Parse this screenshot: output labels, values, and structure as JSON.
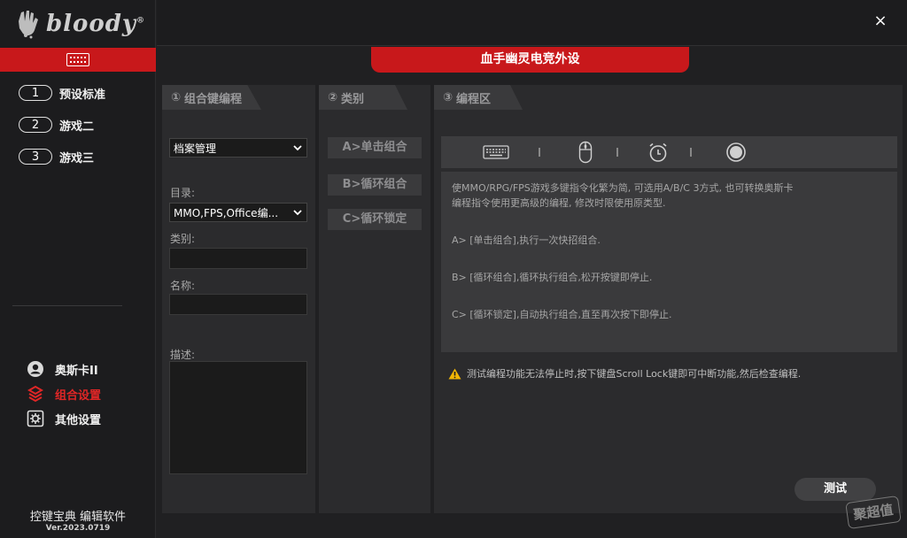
{
  "app": {
    "logo_text": "bloody",
    "logo_trademark": "®",
    "banner_title": "血手幽灵电竞外设",
    "close_symbol": "×",
    "accent_color": "#c8181b"
  },
  "sidebar": {
    "profiles": [
      {
        "number": "1",
        "label": "预设标准"
      },
      {
        "number": "2",
        "label": "游戏二"
      },
      {
        "number": "3",
        "label": "游戏三"
      }
    ],
    "menu": [
      {
        "label": "奥斯卡II",
        "icon": "oscar-icon",
        "active": false
      },
      {
        "label": "组合设置",
        "icon": "layers-icon",
        "active": true
      },
      {
        "label": "其他设置",
        "icon": "gear-icon",
        "active": false
      }
    ],
    "software_name": "控键宝典 编辑软件",
    "version": "Ver.2023.0719"
  },
  "panel_combo": {
    "index": "①",
    "title": "组合键编程",
    "file_select": "档案管理",
    "directory_label": "目录:",
    "directory_value": "MMO,FPS,Office编...",
    "category_label": "类别:",
    "name_label": "名称:",
    "description_label": "描述:"
  },
  "panel_category": {
    "index": "②",
    "title": "类别",
    "buttons": [
      "A>单击组合",
      "B>循环组合",
      "C>循环锁定"
    ]
  },
  "panel_program": {
    "index": "③",
    "title": "编程区",
    "toolbar_icons": [
      "keyboard-icon",
      "mouse-icon",
      "timer-icon",
      "record-icon"
    ],
    "description": {
      "line1": "使MMO/RPG/FPS游戏多键指令化繁为简, 可选用A/B/C 3方式, 也可转换奥斯卡",
      "line2": "编程指令使用更高级的编程, 修改时限使用原类型.",
      "item_a": "A> [单击组合],执行一次快招组合.",
      "item_b": "B> [循环组合],循环执行组合,松开按键即停止.",
      "item_c": "C> [循环锁定],自动执行组合,直至再次按下即停止."
    },
    "warning": "测试编程功能无法停止时,按下键盘Scroll Lock键即可中断功能,然后检查编程.",
    "test_button": "测试"
  },
  "watermark": "聚超值"
}
